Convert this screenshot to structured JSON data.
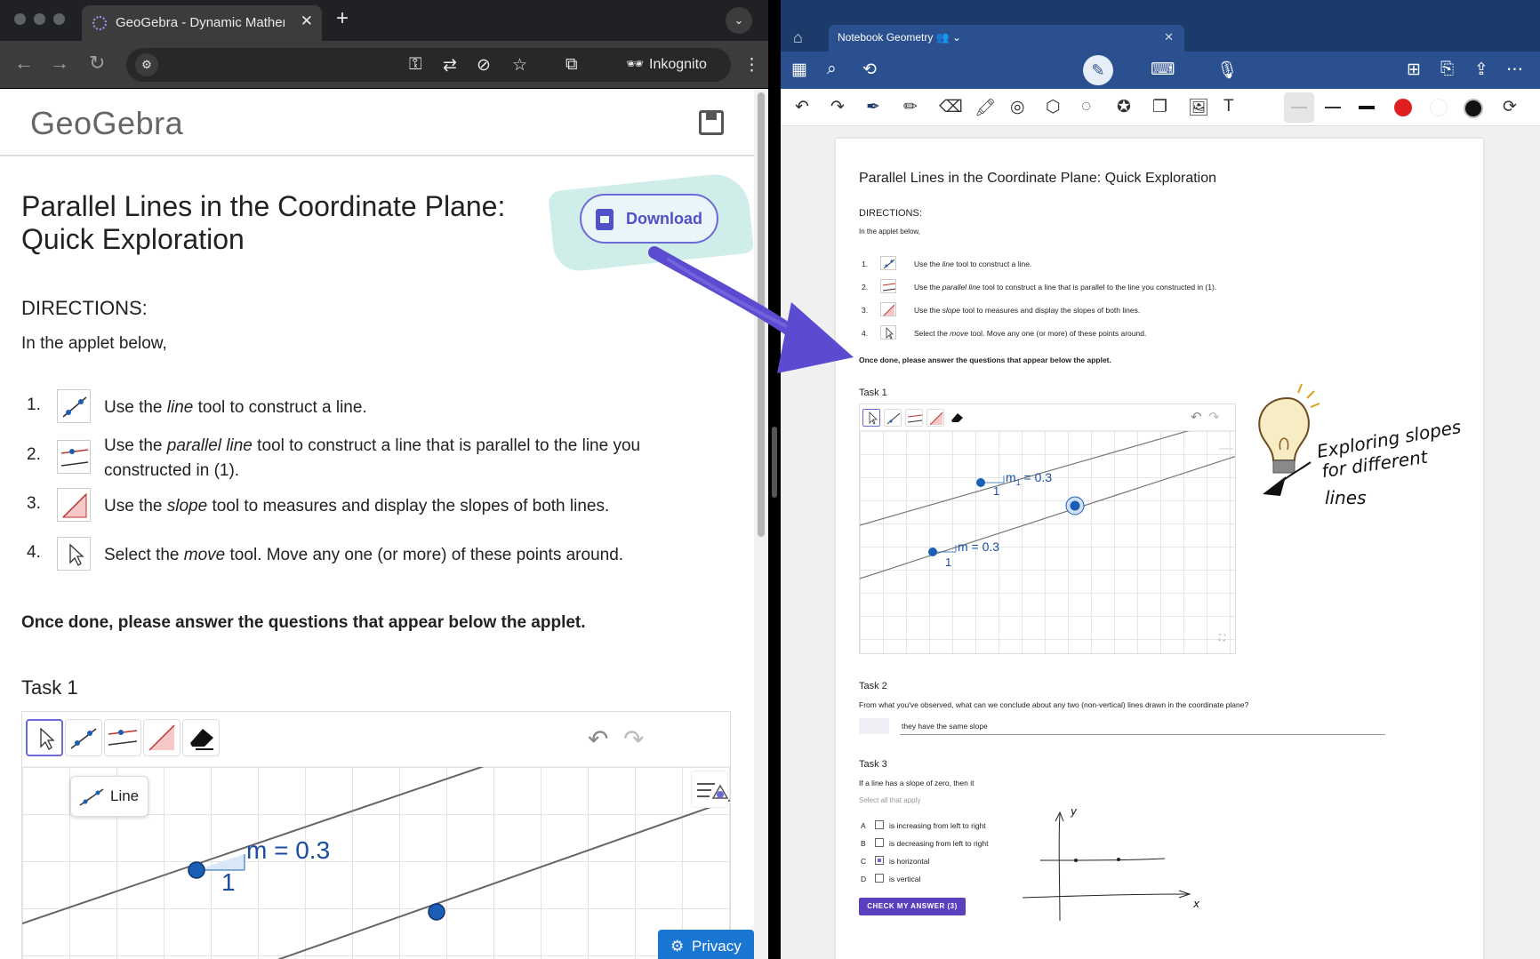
{
  "browser": {
    "tab_title": "GeoGebra - Dynamic Mathem",
    "incognito_label": "Inkognito"
  },
  "geogebra": {
    "logo": "GeoGebra",
    "title": "Parallel Lines in the Coordinate Plane: Quick Exploration",
    "download_label": "Download",
    "directions_heading": "DIRECTIONS:",
    "intro": "In the applet below,",
    "steps": [
      {
        "num": "1.",
        "pre": "Use the ",
        "em": "line",
        "post": " tool to construct a line."
      },
      {
        "num": "2.",
        "pre": "Use the ",
        "em": "parallel line",
        "post": " tool to construct a line that is parallel to the line you constructed in (1)."
      },
      {
        "num": "3.",
        "pre": "Use the ",
        "em": "slope",
        "post": " tool to measures and display the slopes of both lines."
      },
      {
        "num": "4.",
        "pre": "Select the ",
        "em": "move",
        "post": " tool.  Move any one (or more) of these points around."
      }
    ],
    "once_done": "Once done, please answer the questions that appear below the applet.",
    "task1": "Task 1",
    "tooltip": "Line",
    "slope_label": "m = 0.3",
    "run_label": "1",
    "privacy_label": "Privacy"
  },
  "notebook": {
    "tab_title": "Notebook Geometry",
    "doc": {
      "title": "Parallel Lines in the Coordinate Plane: Quick Exploration",
      "directions": "DIRECTIONS:",
      "intro": "In the applet below,",
      "steps": [
        {
          "num": "1.",
          "pre": "Use the ",
          "em": "line",
          "post": " tool to construct a line."
        },
        {
          "num": "2.",
          "pre": "Use the ",
          "em": "parallel line",
          "post": " tool to construct a line that is parallel to the line you constructed in (1)."
        },
        {
          "num": "3.",
          "pre": "Use the ",
          "em": "slope",
          "post": " tool to measures and display the slopes of both lines."
        },
        {
          "num": "4.",
          "pre": "Select the ",
          "em": "move",
          "post": " tool.  Move any one (or more) of these points around."
        }
      ],
      "once_done": "Once done, please answer the questions that appear below the applet.",
      "task1": "Task 1",
      "slope1": "m = 0.3",
      "slope1_sub": "1",
      "slope1_prefix": "m",
      "slope1_rest": " = 0.3",
      "run": "1",
      "task2": "Task 2",
      "task2_q": "From what you've observed, what can we conclude about any two (non-vertical) lines drawn in the coordinate plane?",
      "task2_answer": "they have the same slope",
      "task3": "Task 3",
      "task3_q": "If a line has a slope of zero, then it",
      "task3_hint": "Select all that apply",
      "options": [
        {
          "letter": "A",
          "text": "is increasing from left to right",
          "checked": false
        },
        {
          "letter": "B",
          "text": "is decreasing from left to right",
          "checked": false
        },
        {
          "letter": "C",
          "text": "is horizontal",
          "checked": true
        },
        {
          "letter": "D",
          "text": "is vertical",
          "checked": false
        }
      ],
      "check_button": "CHECK MY ANSWER (3)"
    },
    "annotation": {
      "line1": "Exploring slopes",
      "line2": "for different",
      "line3": "lines",
      "axis_x": "x",
      "axis_y": "y"
    }
  },
  "colors": {
    "accent": "#6b6bd6",
    "arrow": "#5a4bd1",
    "highlight": "#cfeee9",
    "nb_blue": "#2a5090",
    "point": "#1a5fb4",
    "ink_red": "#e02020"
  }
}
